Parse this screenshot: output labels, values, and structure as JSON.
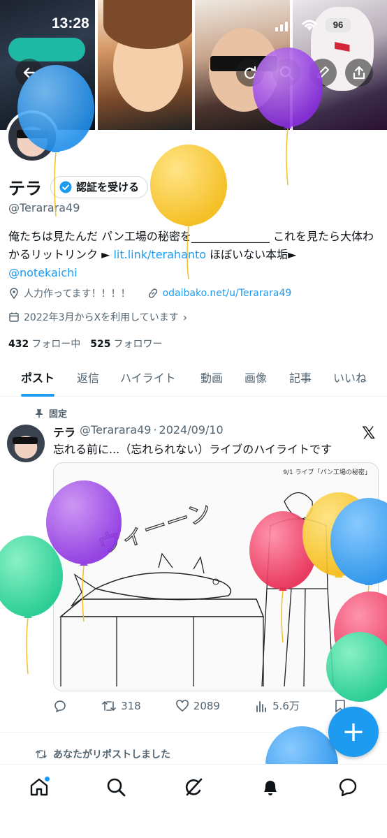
{
  "status_bar": {
    "time": "13:28",
    "battery": "96"
  },
  "profile": {
    "name": "テラ",
    "verify_button": "認証を受ける",
    "handle": "@Terarara49",
    "bio_text_1": "俺たちは見たんだ パン工場の秘密を______________ これを見たら大体わかるリットリンク ► ",
    "bio_link_1": "lit.link/terahanto",
    "bio_text_2": " ほぼいない本垢►",
    "bio_link_2": "@notekaichi",
    "occupation": "人力作ってます！！！！",
    "website": "odaibako.net/u/Terarara49",
    "joined": "2022年3月からXを利用しています",
    "following_count": "432",
    "following_label": "フォロー中",
    "followers_count": "525",
    "followers_label": "フォロワー"
  },
  "tabs": [
    "ポスト",
    "返信",
    "ハイライト",
    "動画",
    "画像",
    "記事",
    "いいね"
  ],
  "pinned_post": {
    "pinned_label": "固定",
    "author": "テラ",
    "handle": "@Terarara49",
    "separator": "·",
    "date": "2024/09/10",
    "text": "忘れる前に...（忘れられない）ライブのハイライトです",
    "media_caption": "9/1 ライブ「パン工場の秘密」",
    "sketch_text": "ウィーーン",
    "retweets": "318",
    "likes": "2089",
    "views": "5.6万"
  },
  "next_post": {
    "repost_note": "あなたがリポストしました"
  },
  "colors": {
    "accent": "#1d9bf0",
    "text": "#0f1419",
    "muted": "#536471"
  },
  "icons": {
    "back": "back-arrow-icon",
    "refresh": "refresh-icon",
    "search": "search-icon",
    "edit": "pencil-icon",
    "share": "share-icon",
    "verified": "verified-badge-icon",
    "location": "location-pin-icon",
    "link": "link-icon",
    "calendar": "calendar-icon",
    "pin": "pin-icon",
    "x": "x-logo-icon",
    "reply": "reply-icon",
    "retweet": "retweet-icon",
    "like": "heart-icon",
    "views": "views-icon",
    "bookmark": "bookmark-icon",
    "compose": "plus-icon",
    "nav": [
      "home-icon",
      "search-icon",
      "grok-icon",
      "bell-icon",
      "messages-icon"
    ]
  }
}
